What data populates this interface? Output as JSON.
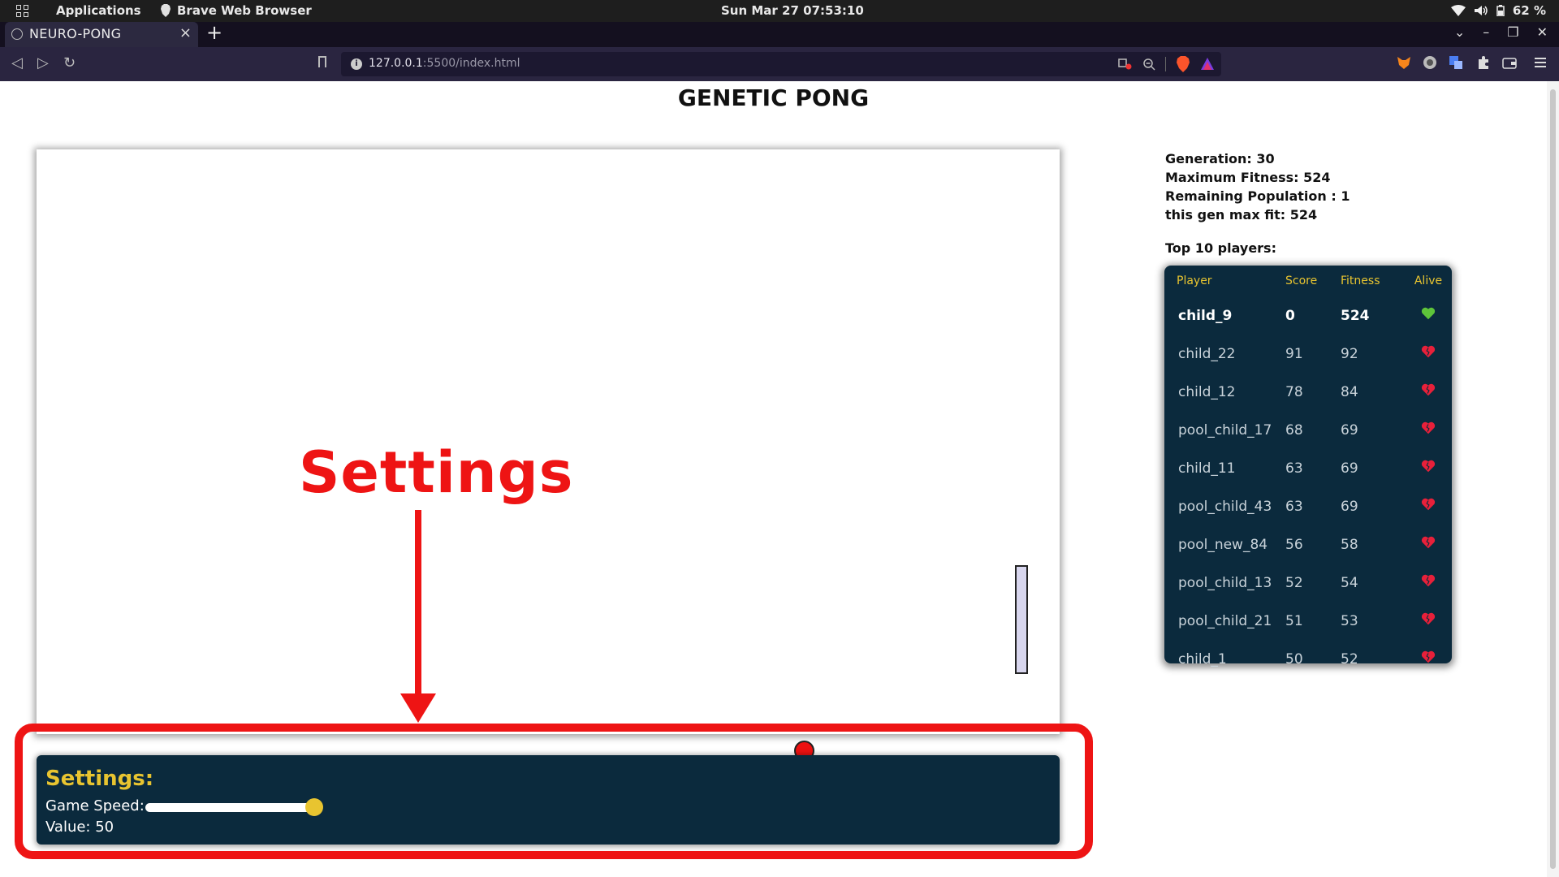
{
  "os_bar": {
    "applications_label": "Applications",
    "browser_label": "Brave Web Browser",
    "datetime": "Sun Mar 27  07:53:10",
    "battery": "62 %"
  },
  "browser": {
    "tab_title": "NEURO-PONG",
    "tab_close": "×",
    "new_tab": "+",
    "url_host": "127.0.0.1",
    "url_rest": ":5500/index.html"
  },
  "page": {
    "title": "GENETIC PONG"
  },
  "stats": {
    "generation": "Generation: 30",
    "max_fitness": "Maximum Fitness: 524",
    "remaining_population": "Remaining Population : 1",
    "gen_max_fit": "this gen max fit: 524"
  },
  "leaderboard": {
    "label": "Top 10 players:",
    "headers": [
      "Player",
      "Score",
      "Fitness",
      "Alive"
    ],
    "rows": [
      {
        "player": "child_9",
        "score": "0",
        "fitness": "524",
        "alive": true
      },
      {
        "player": "child_22",
        "score": "91",
        "fitness": "92",
        "alive": false
      },
      {
        "player": "child_12",
        "score": "78",
        "fitness": "84",
        "alive": false
      },
      {
        "player": "pool_child_17",
        "score": "68",
        "fitness": "69",
        "alive": false
      },
      {
        "player": "child_11",
        "score": "63",
        "fitness": "69",
        "alive": false
      },
      {
        "player": "pool_child_43",
        "score": "63",
        "fitness": "69",
        "alive": false
      },
      {
        "player": "pool_new_84",
        "score": "56",
        "fitness": "58",
        "alive": false
      },
      {
        "player": "pool_child_13",
        "score": "52",
        "fitness": "54",
        "alive": false
      },
      {
        "player": "pool_child_21",
        "score": "51",
        "fitness": "53",
        "alive": false
      },
      {
        "player": "child_1",
        "score": "50",
        "fitness": "52",
        "alive": false
      }
    ]
  },
  "settings": {
    "heading": "Settings:",
    "speed_label": "Game Speed:",
    "value_line": "Value: 50",
    "speed_value": 50
  },
  "annotation": {
    "label": "Settings"
  },
  "colors": {
    "panel_bg": "#0b2a3d",
    "accent_yellow": "#e8c430",
    "annotation_red": "#ee1414",
    "ball": "#ee1111",
    "paddle": "#d8d6ee",
    "alive_heart": "#5ec43a",
    "dead_heart": "#e8203a"
  },
  "icons": {
    "alive": "green-heart-icon",
    "dead": "broken-heart-icon"
  }
}
